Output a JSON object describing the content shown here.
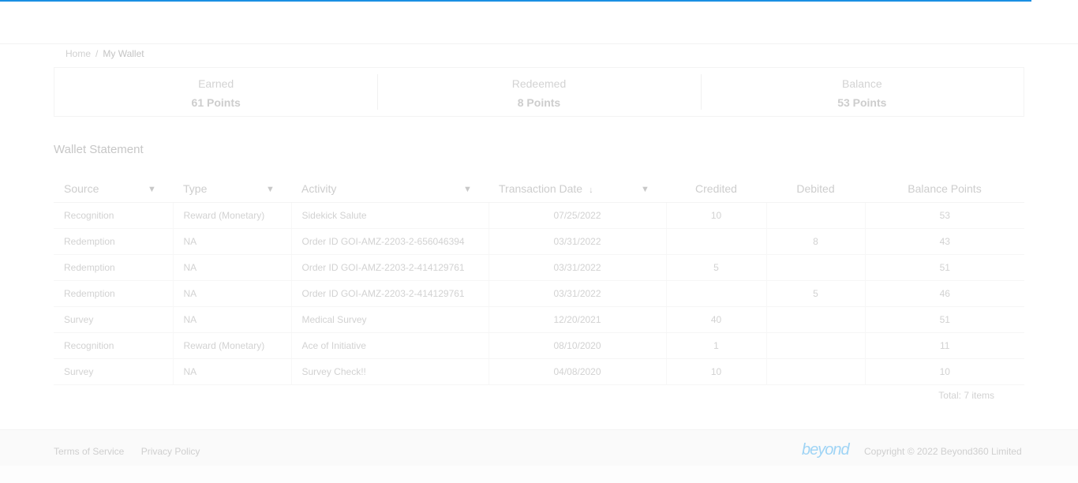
{
  "breadcrumb": {
    "home": "Home",
    "separator": "/",
    "current": "My Wallet"
  },
  "summary": [
    {
      "label": "Earned",
      "value": "61 Points"
    },
    {
      "label": "Redeemed",
      "value": "8 Points"
    },
    {
      "label": "Balance",
      "value": "53 Points"
    }
  ],
  "statement": {
    "title": "Wallet Statement",
    "columns": {
      "source": "Source",
      "type": "Type",
      "activity": "Activity",
      "date": "Transaction Date",
      "credited": "Credited",
      "debited": "Debited",
      "balance": "Balance Points"
    },
    "rows": [
      {
        "source": "Recognition",
        "type": "Reward (Monetary)",
        "activity": "Sidekick Salute",
        "date": "07/25/2022",
        "credited": "10",
        "debited": "",
        "balance": "53"
      },
      {
        "source": "Redemption",
        "type": "NA",
        "activity": "Order ID GOI-AMZ-2203-2-656046394",
        "date": "03/31/2022",
        "credited": "",
        "debited": "8",
        "balance": "43"
      },
      {
        "source": "Redemption",
        "type": "NA",
        "activity": "Order ID GOI-AMZ-2203-2-414129761",
        "date": "03/31/2022",
        "credited": "5",
        "debited": "",
        "balance": "51"
      },
      {
        "source": "Redemption",
        "type": "NA",
        "activity": "Order ID GOI-AMZ-2203-2-414129761",
        "date": "03/31/2022",
        "credited": "",
        "debited": "5",
        "balance": "46"
      },
      {
        "source": "Survey",
        "type": "NA",
        "activity": "Medical Survey",
        "date": "12/20/2021",
        "credited": "40",
        "debited": "",
        "balance": "51"
      },
      {
        "source": "Recognition",
        "type": "Reward (Monetary)",
        "activity": "Ace of Initiative",
        "date": "08/10/2020",
        "credited": "1",
        "debited": "",
        "balance": "11"
      },
      {
        "source": "Survey",
        "type": "NA",
        "activity": "Survey Check!!",
        "date": "04/08/2020",
        "credited": "10",
        "debited": "",
        "balance": "10"
      }
    ],
    "total": "Total: 7 items"
  },
  "footer": {
    "terms": "Terms of Service",
    "privacy": "Privacy Policy",
    "brand": "beyond",
    "copyright": "Copyright © 2022 Beyond360 Limited"
  },
  "colors": {
    "accent": "#1a8fe3",
    "brand": "#9fd4f5"
  },
  "icons": {
    "filter": "filter-icon",
    "sort": "sort-down-icon"
  }
}
